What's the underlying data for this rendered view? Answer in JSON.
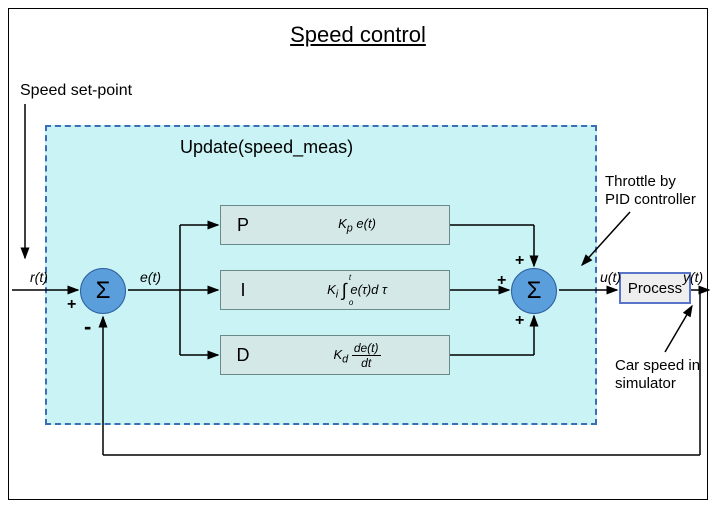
{
  "title": "Speed control",
  "labels": {
    "setpoint": "Speed set-point",
    "update": "Update(speed_meas)",
    "throttle": "Throttle by\nPID controller",
    "carspeed": "Car speed in\nsimulator",
    "process": "Process"
  },
  "signals": {
    "r": "r(t)",
    "e": "e(t)",
    "u": "u(t)",
    "y": "y(t)"
  },
  "blocks": {
    "P": {
      "letter": "P",
      "formula_html": "K<sub>p</sub> e(t)"
    },
    "I": {
      "letter": "I",
      "formula_html": "K<sub>i</sub> ∫ e(τ) dτ"
    },
    "D": {
      "letter": "D",
      "formula_html": "K<sub>d</sub> de(t)/dt"
    }
  },
  "sum_symbol": "Σ",
  "plus": "+",
  "minus": "-",
  "chart_data": {
    "type": "block-diagram",
    "title": "Speed control",
    "container": "Update(speed_meas)",
    "nodes": [
      {
        "id": "input_r",
        "label": "r(t)",
        "desc": "Speed set-point",
        "type": "input"
      },
      {
        "id": "sum1",
        "type": "sum",
        "inputs": [
          {
            "from": "input_r",
            "sign": "+"
          },
          {
            "from": "feedback_y",
            "sign": "-"
          }
        ],
        "output_label": "e(t)"
      },
      {
        "id": "P",
        "type": "gain",
        "label": "P",
        "expr": "K_p * e(t)"
      },
      {
        "id": "I",
        "type": "integral",
        "label": "I",
        "expr": "K_i * ∫_0^t e(τ) dτ"
      },
      {
        "id": "D",
        "type": "derivative",
        "label": "D",
        "expr": "K_d * de(t)/dt"
      },
      {
        "id": "sum2",
        "type": "sum",
        "inputs": [
          {
            "from": "P",
            "sign": "+"
          },
          {
            "from": "I",
            "sign": "+"
          },
          {
            "from": "D",
            "sign": "+"
          }
        ],
        "output_label": "u(t)",
        "desc": "Throttle by PID controller"
      },
      {
        "id": "process",
        "type": "block",
        "label": "Process",
        "output_label": "y(t)",
        "desc": "Car speed in simulator"
      },
      {
        "id": "feedback_y",
        "type": "feedback",
        "from": "process",
        "to": "sum1"
      }
    ],
    "edges": [
      [
        "input_r",
        "sum1"
      ],
      [
        "sum1",
        "P"
      ],
      [
        "sum1",
        "I"
      ],
      [
        "sum1",
        "D"
      ],
      [
        "P",
        "sum2"
      ],
      [
        "I",
        "sum2"
      ],
      [
        "D",
        "sum2"
      ],
      [
        "sum2",
        "process"
      ],
      [
        "process",
        "feedback_y"
      ]
    ]
  }
}
